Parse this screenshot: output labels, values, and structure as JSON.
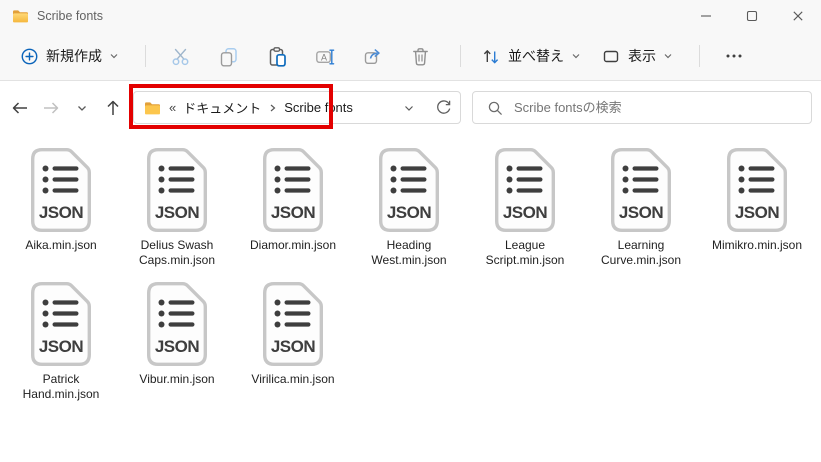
{
  "titlebar": {
    "title": "Scribe fonts"
  },
  "toolbar": {
    "new_label": "新規作成",
    "sort_label": "並べ替え",
    "view_label": "表示"
  },
  "navigation": {
    "breadcrumb_overflow": "«",
    "breadcrumb": [
      "ドキュメント",
      "Scribe fonts"
    ]
  },
  "search": {
    "placeholder": "Scribe fontsの検索"
  },
  "files": {
    "icon_label": "JSON",
    "items": [
      {
        "name": "Aika.min.json",
        "lines": [
          "Aika.min.json"
        ]
      },
      {
        "name": "Delius Swash Caps.min.json",
        "lines": [
          "Delius Swash",
          "Caps.min.json"
        ]
      },
      {
        "name": "Diamor.min.json",
        "lines": [
          "Diamor.min.json"
        ]
      },
      {
        "name": "Heading West.min.json",
        "lines": [
          "Heading",
          "West.min.json"
        ]
      },
      {
        "name": "League Script.min.json",
        "lines": [
          "League",
          "Script.min.json"
        ]
      },
      {
        "name": "Learning Curve.min.json",
        "lines": [
          "Learning",
          "Curve.min.json"
        ]
      },
      {
        "name": "Mimikro.min.json",
        "lines": [
          "Mimikro.min.json"
        ]
      },
      {
        "name": "Patrick Hand.min.json",
        "lines": [
          "Patrick",
          "Hand.min.json"
        ]
      },
      {
        "name": "Vibur.min.json",
        "lines": [
          "Vibur.min.json"
        ]
      },
      {
        "name": "Virilica.min.json",
        "lines": [
          "Virilica.min.json"
        ]
      }
    ]
  },
  "colors": {
    "accent_blue": "#0b64ba",
    "annotation_red": "#e30000",
    "folder_yellow": "#fcc64d",
    "icon_gray": "#3e3e3e"
  }
}
